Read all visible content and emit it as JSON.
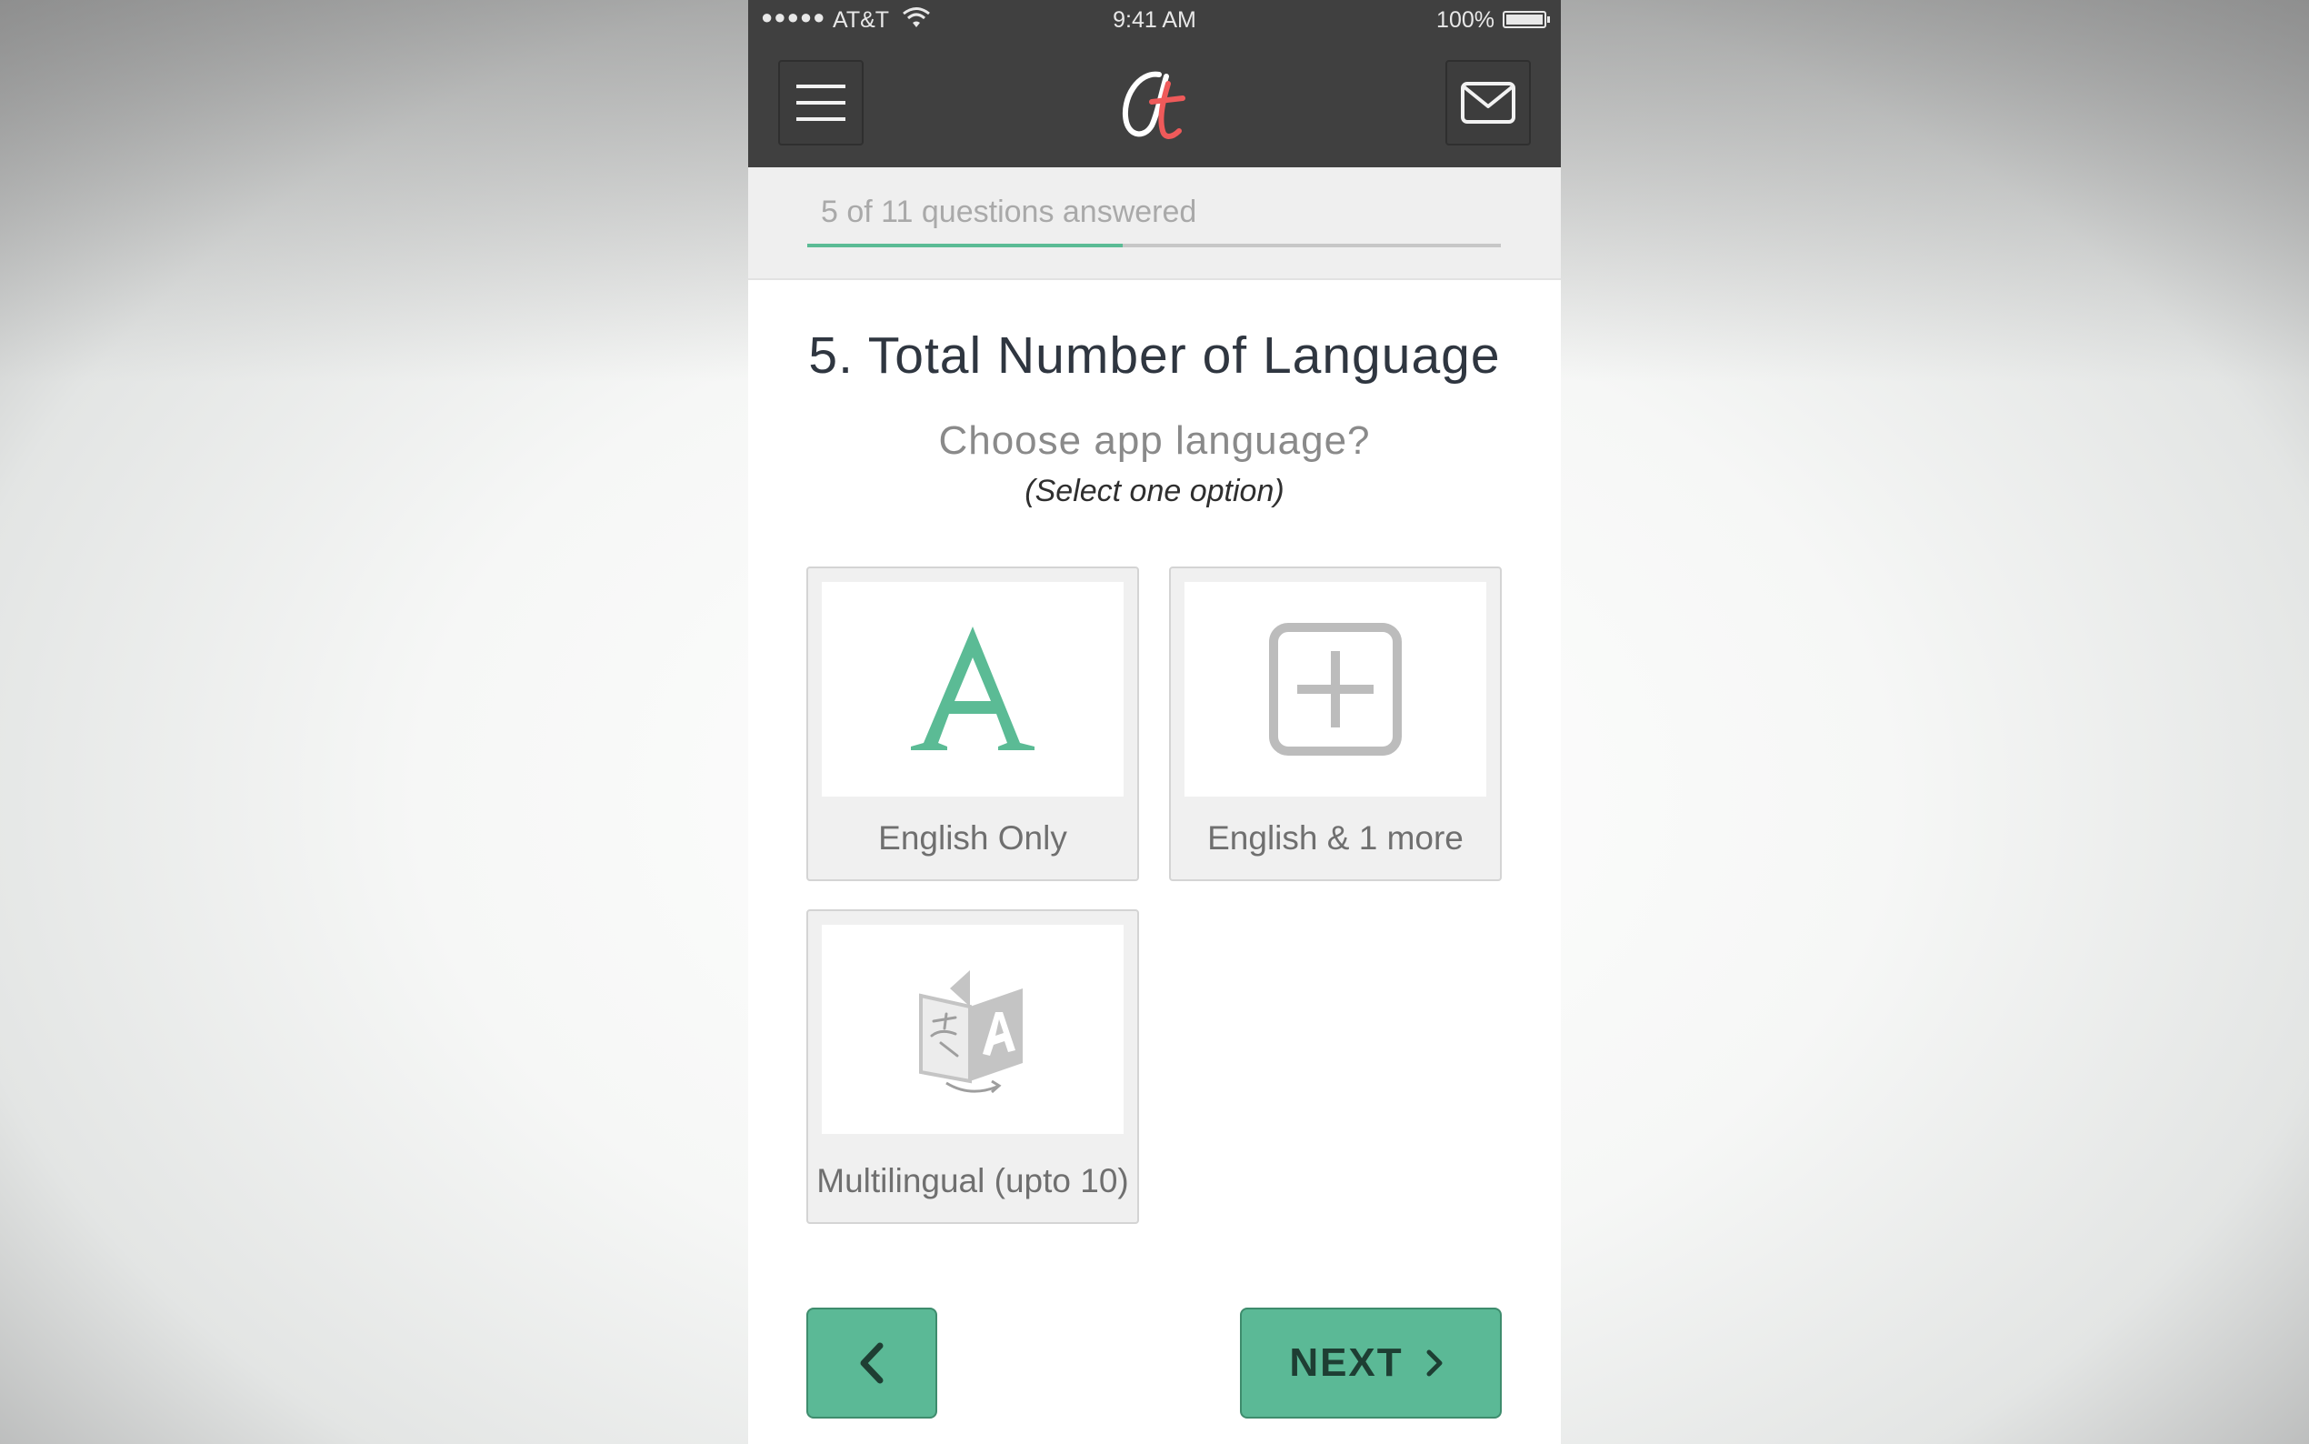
{
  "status_bar": {
    "signal": "●●●●●",
    "carrier": "AT&T",
    "time": "9:41 AM",
    "battery": "100%"
  },
  "header": {
    "menu_icon": "hamburger-menu-icon",
    "logo_icon": "app-logo-icon",
    "mail_icon": "envelope-icon"
  },
  "progress": {
    "text": "5 of 11 questions answered",
    "answered": 5,
    "total": 11,
    "fill_color": "#5bbb95"
  },
  "question": {
    "title": "5. Total Number of Language",
    "subtitle": "Choose app language?",
    "hint": "(Select one option)"
  },
  "options": [
    {
      "label": "English Only",
      "icon": "letter-a-icon"
    },
    {
      "label": "English & 1 more",
      "icon": "plus-square-icon"
    },
    {
      "label": "Multilingual (upto 10)",
      "icon": "translate-icon"
    }
  ],
  "nav": {
    "back_icon": "chevron-left-icon",
    "next_label": "NEXT",
    "next_icon": "chevron-right-icon",
    "button_color": "#5bb996"
  }
}
